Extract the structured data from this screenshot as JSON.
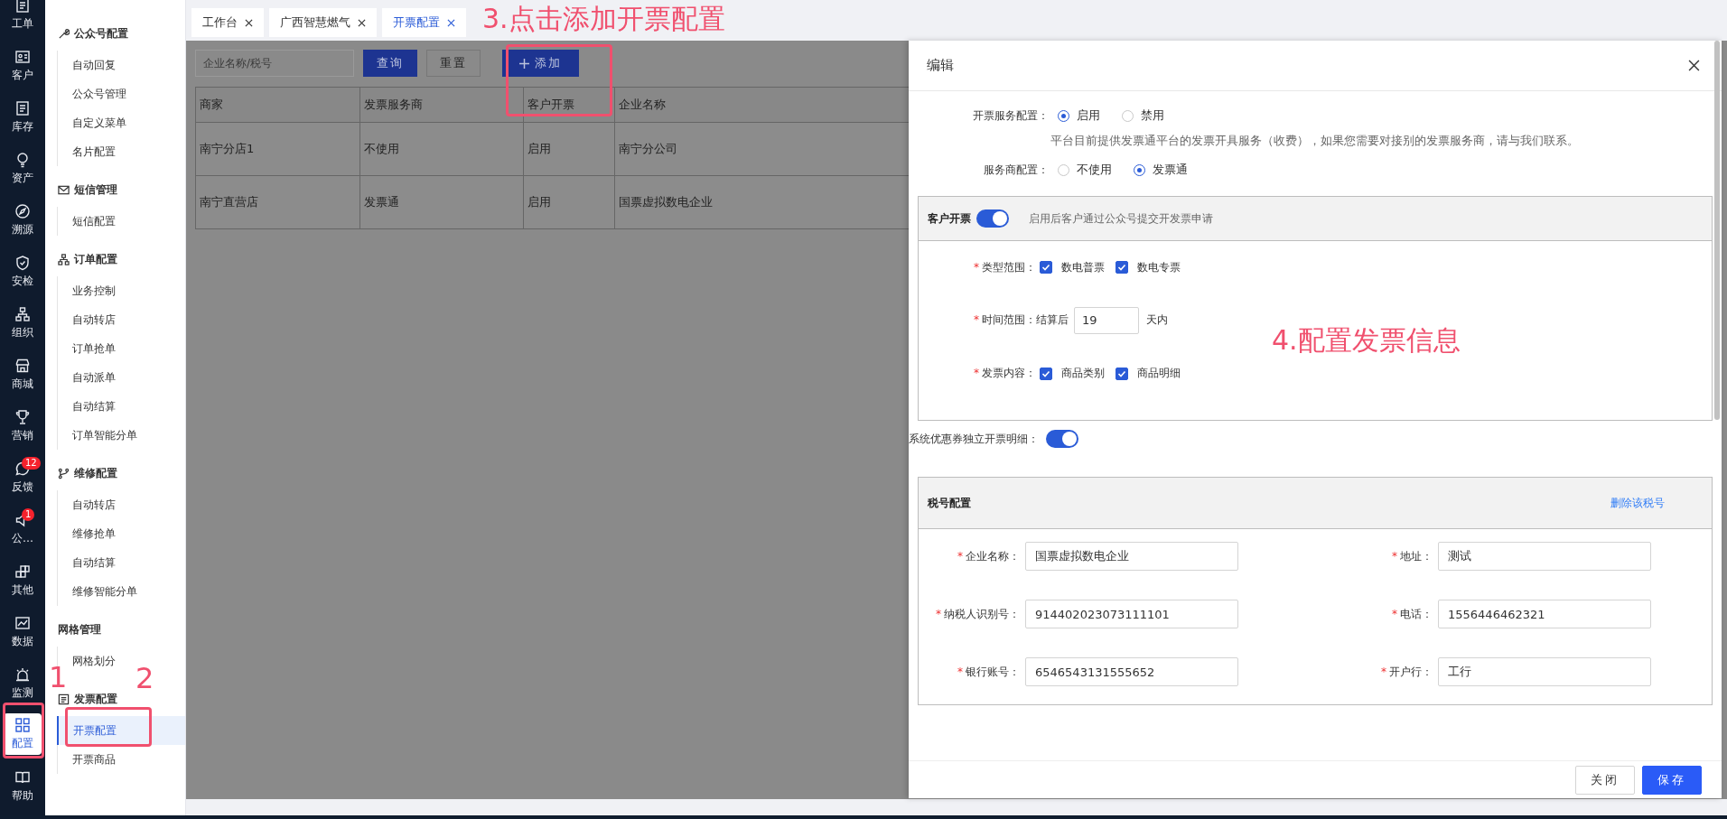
{
  "nav_rail": {
    "items": [
      {
        "label": "工单",
        "selected": false
      },
      {
        "label": "客户",
        "selected": false
      },
      {
        "label": "库存",
        "selected": false
      },
      {
        "label": "资产",
        "selected": false
      },
      {
        "label": "溯源",
        "selected": false
      },
      {
        "label": "安检",
        "selected": false
      },
      {
        "label": "组织",
        "selected": false
      },
      {
        "label": "商城",
        "selected": false
      },
      {
        "label": "营销",
        "selected": false
      },
      {
        "label": "反馈",
        "selected": false,
        "badge": "12"
      },
      {
        "label": "公…",
        "selected": false,
        "badge": "1"
      },
      {
        "label": "其他",
        "selected": false
      },
      {
        "label": "数据",
        "selected": false
      },
      {
        "label": "监测",
        "selected": false
      },
      {
        "label": "配置",
        "selected": true
      },
      {
        "label": "帮助",
        "selected": false
      }
    ]
  },
  "submenu": {
    "groups": [
      {
        "title": "公众号配置",
        "items": [
          {
            "label": "自动回复",
            "selected": false
          },
          {
            "label": "公众号管理",
            "selected": false
          },
          {
            "label": "自定义菜单",
            "selected": false
          },
          {
            "label": "名片配置",
            "selected": false
          }
        ]
      },
      {
        "title": "短信管理",
        "items": [
          {
            "label": "短信配置",
            "selected": false
          }
        ]
      },
      {
        "title": "订单配置",
        "items": [
          {
            "label": "业务控制",
            "selected": false
          },
          {
            "label": "自动转店",
            "selected": false
          },
          {
            "label": "订单抢单",
            "selected": false
          },
          {
            "label": "自动派单",
            "selected": false
          },
          {
            "label": "自动结算",
            "selected": false
          },
          {
            "label": "订单智能分单",
            "selected": false
          }
        ]
      },
      {
        "title": "维修配置",
        "items": [
          {
            "label": "自动转店",
            "selected": false
          },
          {
            "label": "维修抢单",
            "selected": false
          },
          {
            "label": "自动结算",
            "selected": false
          },
          {
            "label": "维修智能分单",
            "selected": false
          }
        ]
      },
      {
        "title": "网格管理",
        "items": [
          {
            "label": "网格划分",
            "selected": false
          }
        ]
      },
      {
        "title": "发票配置",
        "items": [
          {
            "label": "开票配置",
            "selected": true
          },
          {
            "label": "开票商品",
            "selected": false
          }
        ]
      }
    ]
  },
  "tabs": [
    {
      "label": "工作台",
      "selected": false
    },
    {
      "label": "广西智慧燃气",
      "selected": false
    },
    {
      "label": "开票配置",
      "selected": true
    }
  ],
  "toolbar": {
    "search_placeholder": "企业名称/税号",
    "buttons": [
      {
        "label": "查询",
        "kind": "primary"
      },
      {
        "label": "重置",
        "kind": "default"
      },
      {
        "label": "添加",
        "kind": "add"
      }
    ]
  },
  "table": {
    "columns": [
      "商家",
      "发票服务商",
      "客户开票",
      "企业名称"
    ],
    "rows": [
      [
        "南宁分店1",
        "不使用",
        "启用",
        "南宁分公司"
      ],
      [
        "南宁直营店",
        "发票通",
        "启用",
        "国票虚拟数电企业"
      ]
    ]
  },
  "drawer": {
    "title": "编辑",
    "service_config": {
      "label": "开票服务配置：",
      "options": [
        {
          "label": "启用",
          "selected": true
        },
        {
          "label": "禁用",
          "selected": false
        }
      ],
      "help": "平台目前提供发票通平台的发票开具服务（收费），如果您需要对接别的发票服务商，请与我们联系。"
    },
    "provider_config": {
      "label": "服务商配置：",
      "options": [
        {
          "label": "不使用",
          "selected": false
        },
        {
          "label": "发票通",
          "selected": true
        }
      ]
    },
    "customer_invoice": {
      "title": "客户开票",
      "on": true,
      "hint": "启用后客户通过公众号提交开发票申请",
      "rows": [
        {
          "kind": "checks",
          "mark": "*",
          "label": "类型范围：",
          "options": [
            {
              "label": "数电普票",
              "checked": true
            },
            {
              "label": "数电专票",
              "checked": true
            }
          ]
        },
        {
          "kind": "input",
          "mark": "*",
          "label": "时间范围：",
          "prefix": "结算后",
          "value": "19",
          "suffix": "天内"
        },
        {
          "kind": "checks",
          "mark": "*",
          "label": "发票内容：",
          "options": [
            {
              "label": "商品类别",
              "checked": true
            },
            {
              "label": "商品明细",
              "checked": true
            }
          ]
        }
      ]
    },
    "coupon_detail": {
      "label": "系统优惠券独立开票明细：",
      "on": true
    },
    "tax_config": {
      "title": "税号配置",
      "delete_link": "删除该税号",
      "fields": [
        {
          "mark": "*",
          "label": "企业名称：",
          "value": "国票虚拟数电企业"
        },
        {
          "mark": "*",
          "label": "地址：",
          "value": "测试"
        },
        {
          "mark": "*",
          "label": "纳税人识别号：",
          "value": "914402023073111101"
        },
        {
          "mark": "*",
          "label": "电话：",
          "value": "1556446462321"
        },
        {
          "mark": "*",
          "label": "银行账号：",
          "value": "6546543131555652"
        },
        {
          "mark": "*",
          "label": "开户行：",
          "value": "工行"
        }
      ]
    },
    "footer_buttons": [
      {
        "label": "关闭",
        "kind": "default"
      },
      {
        "label": "保存",
        "kind": "primary"
      }
    ]
  },
  "annotations": [
    "1",
    "2",
    "3.点击添加开票配置",
    "4.配置发票信息"
  ]
}
